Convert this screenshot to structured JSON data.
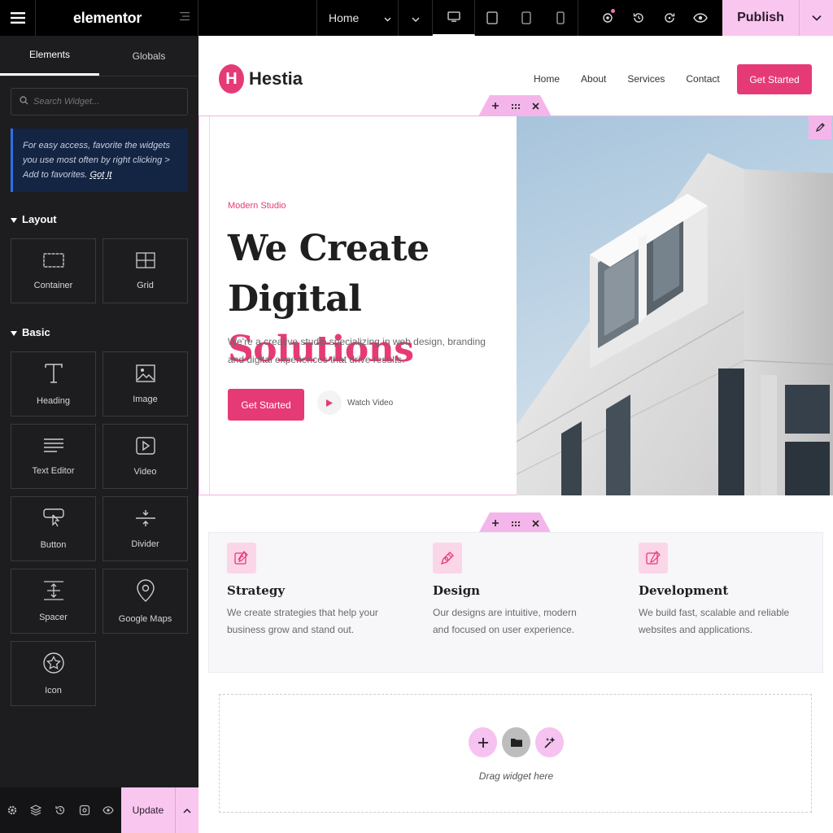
{
  "topbar": {
    "brand": "elementor",
    "page_selector": "Home",
    "publish_label": "Publish"
  },
  "panel": {
    "tabs": [
      {
        "label": "Elements"
      },
      {
        "label": "Globals"
      }
    ],
    "search": {
      "placeholder": "Search Widget..."
    },
    "tip": {
      "text": "For easy access, favorite the widgets you use most often by right clicking > Add to favorites.",
      "link": "Got It"
    },
    "layout_title": "Layout",
    "layout_widgets": [
      {
        "label": "Container",
        "icon": "container-icon"
      },
      {
        "label": "Grid",
        "icon": "grid-icon"
      }
    ],
    "basic_title": "Basic",
    "basic_widgets": [
      {
        "label": "Heading",
        "icon": "heading-icon"
      },
      {
        "label": "Image",
        "icon": "image-icon"
      },
      {
        "label": "Text Editor",
        "icon": "text-editor-icon"
      },
      {
        "label": "Video",
        "icon": "video-icon"
      },
      {
        "label": "Button",
        "icon": "button-icon"
      },
      {
        "label": "Divider",
        "icon": "divider-icon"
      },
      {
        "label": "Spacer",
        "icon": "spacer-icon"
      },
      {
        "label": "Google Maps",
        "icon": "map-pin-icon"
      },
      {
        "label": "Icon",
        "icon": "star-icon"
      }
    ],
    "update_label": "Update"
  },
  "site": {
    "logo_letter": "H",
    "name": "Hestia",
    "nav": [
      {
        "label": "Home"
      },
      {
        "label": "About"
      },
      {
        "label": "Services"
      },
      {
        "label": "Contact"
      }
    ],
    "nav_cta": "Get Started",
    "hero": {
      "eyebrow": "Modern Studio",
      "title_line1": "We Create",
      "title_line2_plain": "Digital",
      "title_line2_accent": "Solutions",
      "lead": "We're a creative studio specializing in web design, branding and digital experiences that drive results.",
      "cta": "Get Started",
      "watch": "Watch Video"
    },
    "features": [
      {
        "title": "Strategy",
        "desc": "We create strategies that help your business grow and stand out."
      },
      {
        "title": "Design",
        "desc": "Our designs are intuitive, modern and focused on user experience."
      },
      {
        "title": "Development",
        "desc": "We build fast, scalable and reliable websites and applications."
      }
    ],
    "dropzone_label": "Drag widget here"
  },
  "colors": {
    "accent": "#e63a76",
    "editor_pink": "#f9c6ef",
    "panel_bg": "#1d1d20",
    "tip_bg": "#142544",
    "tip_border": "#2f6fe3"
  }
}
